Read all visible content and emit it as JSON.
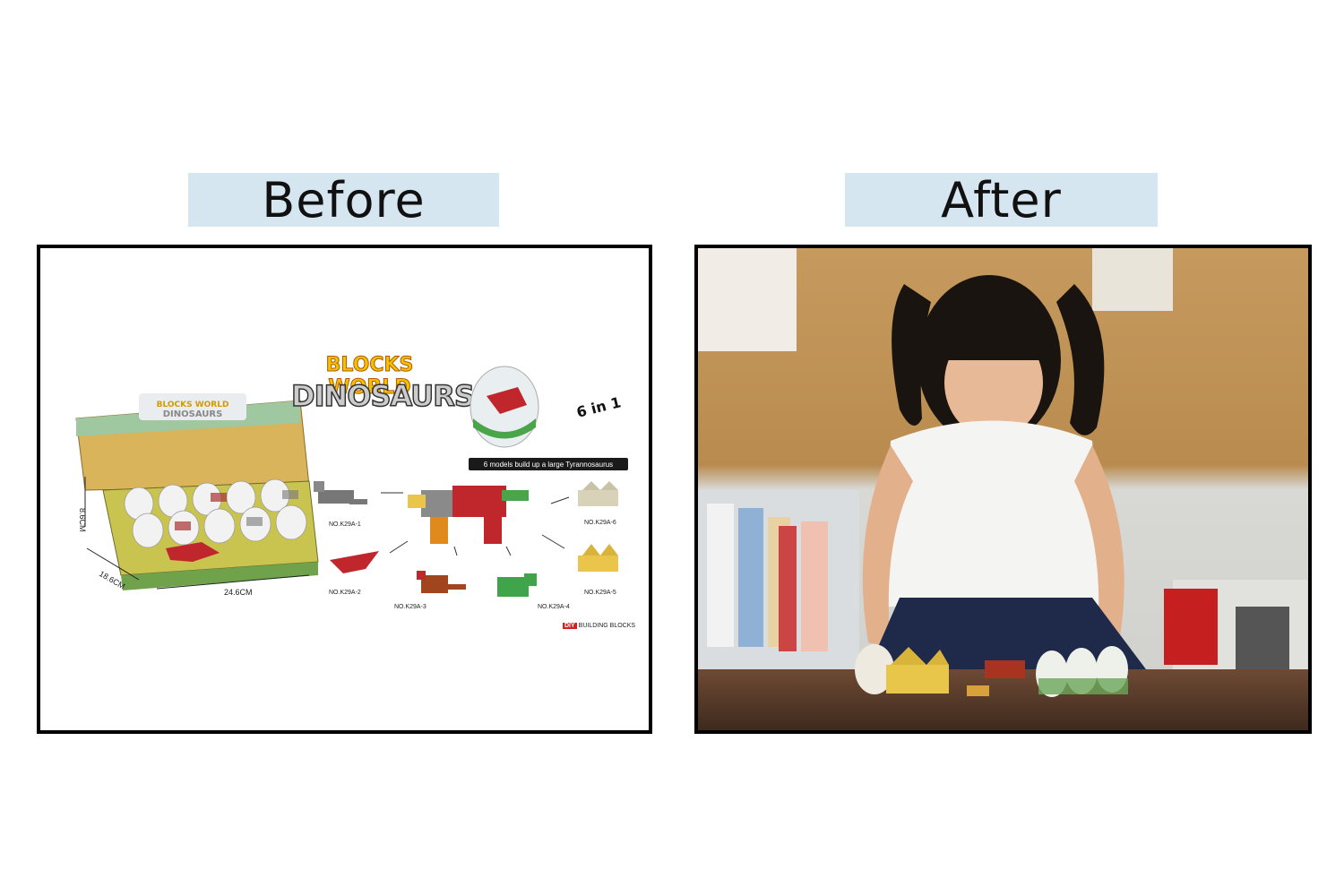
{
  "labels": {
    "before": "Before",
    "after": "After"
  },
  "before_panel": {
    "logo_line1": "BLOCKS WORLD",
    "logo_line2": "DINOSAURS",
    "badge": "6 in 1",
    "tagline": "6 models build up a large Tyrannosaurus",
    "dimensions": {
      "height": "8.6CM",
      "depth": "18.6CM",
      "width": "24.6CM"
    },
    "models": [
      "NO.K29A-1",
      "NO.K29A-2",
      "NO.K29A-3",
      "NO.K29A-4",
      "NO.K29A-5",
      "NO.K29A-6"
    ],
    "diy_tag": "DIY",
    "diy_text": "BUILDING BLOCKS"
  },
  "colors": {
    "label_bg": "#d6e6f1",
    "border": "#000000"
  }
}
